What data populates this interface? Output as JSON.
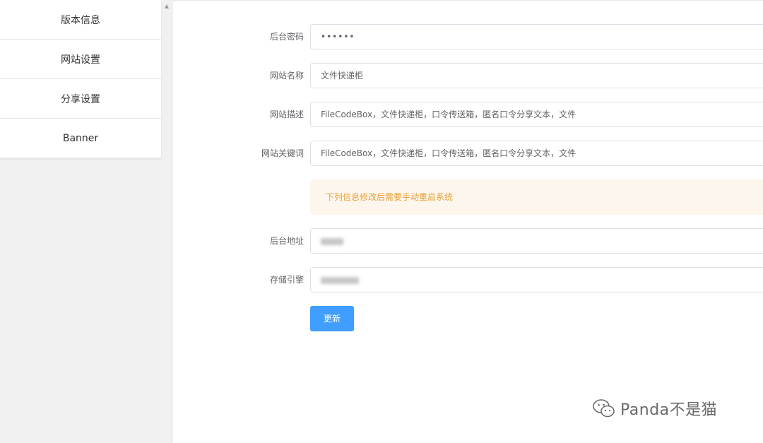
{
  "sidebar": {
    "items": [
      {
        "label": "版本信息"
      },
      {
        "label": "网站设置"
      },
      {
        "label": "分享设置"
      },
      {
        "label": "Banner"
      }
    ]
  },
  "form": {
    "admin_password": {
      "label": "后台密码",
      "value": "••••••"
    },
    "site_name": {
      "label": "网站名称",
      "value": "文件快递柜"
    },
    "site_description": {
      "label": "网站描述",
      "value": "FileCodeBox，文件快递柜，口令传送箱，匿名口令分享文本，文件"
    },
    "site_keywords": {
      "label": "网站关键词",
      "value": "FileCodeBox，文件快递柜，口令传送箱，匿名口令分享文本，文件"
    },
    "notice": "下列信息修改后需要手动重启系统",
    "admin_address": {
      "label": "后台地址"
    },
    "storage_engine": {
      "label": "存储引擎"
    },
    "update_button": "更新"
  },
  "watermark": {
    "text": "Panda不是猫",
    "icon": "wechat-icon"
  },
  "colors": {
    "primary": "#409eff",
    "warning_bg": "#fdf6ec",
    "warning_text": "#e6a23c"
  }
}
